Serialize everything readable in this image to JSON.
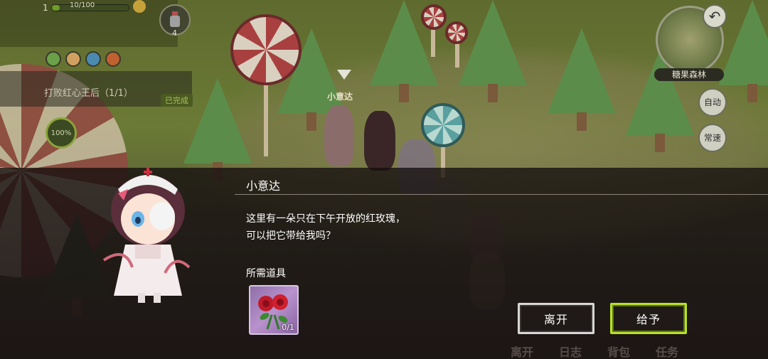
{
  "hud": {
    "level": "1",
    "hp_text": "10/100",
    "potion_count": "4",
    "quest_text": "打败红心王后（1/1）",
    "quest_status": "已完成",
    "progress_text": "100%"
  },
  "map": {
    "name": "糖果森林",
    "buttons": {
      "auto": "自动",
      "speed": "常速"
    }
  },
  "scene": {
    "npc_label": "小意达"
  },
  "dialog": {
    "speaker": "小意达",
    "lines": [
      "这里有一朵只在下午开放的红玫瑰，",
      "可以把它带给我吗？"
    ],
    "required_label": "所需道具",
    "item": {
      "icon": "red-rose-icon",
      "count": "0/1"
    },
    "buttons": {
      "leave": "离开",
      "give": "给予"
    }
  },
  "bottom_menu": [
    "离开",
    "日志",
    "背包",
    "任务"
  ],
  "colors": {
    "give_border": "#b8e02a",
    "leave_border": "#d8d8d8",
    "item_bg": "#b892cc"
  }
}
